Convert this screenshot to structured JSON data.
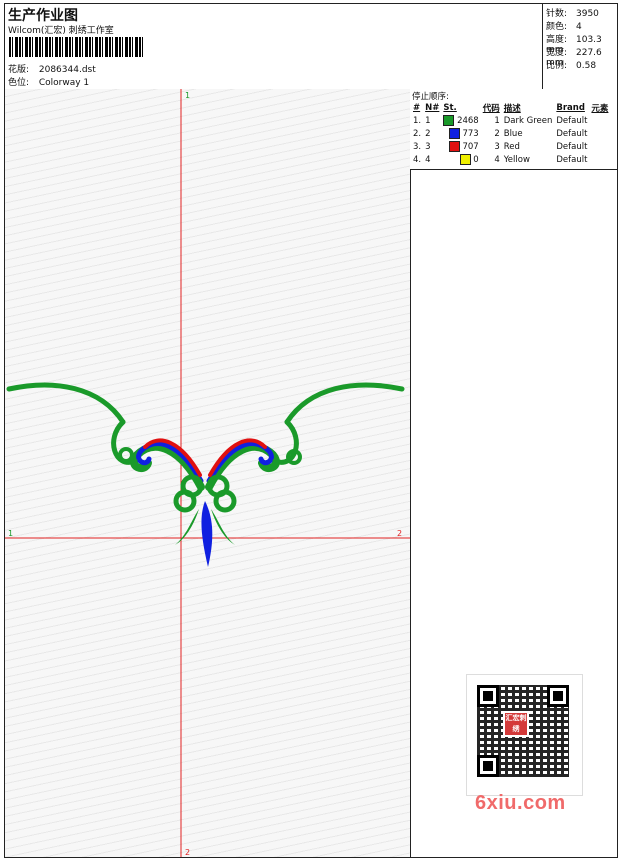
{
  "header": {
    "title": "生产作业图",
    "subtitle": "Wilcom(汇宏) 刺绣工作室",
    "pattern_label": "花版:",
    "pattern_value": "2086344.dst",
    "colorway_label": "色位:",
    "colorway_value": "Colorway 1"
  },
  "stats": [
    {
      "label": "针数:",
      "value": "3950"
    },
    {
      "label": "颜色:",
      "value": "4"
    },
    {
      "label": "高度:",
      "value": "103.3 mm"
    },
    {
      "label": "宽度:",
      "value": "227.6 mm"
    },
    {
      "label": "比例:",
      "value": "0.58"
    }
  ],
  "stop_sequence": {
    "caption": "停止顺序:",
    "columns": [
      "#",
      "N#",
      "St.",
      "代码",
      "描述",
      "Brand",
      "元素"
    ],
    "rows": [
      {
        "num": "1.",
        "n": "1",
        "color": "#1a9a2a",
        "stitches": "2468",
        "code": "1",
        "desc": "Dark Green",
        "brand": "Default"
      },
      {
        "num": "2.",
        "n": "2",
        "color": "#1020e0",
        "stitches": "773",
        "code": "2",
        "desc": "Blue",
        "brand": "Default"
      },
      {
        "num": "3.",
        "n": "3",
        "color": "#e01010",
        "stitches": "707",
        "code": "3",
        "desc": "Red",
        "brand": "Default"
      },
      {
        "num": "4.",
        "n": "4",
        "color": "#f0f000",
        "stitches": "0",
        "code": "4",
        "desc": "Yellow",
        "brand": "Default"
      }
    ]
  },
  "design": {
    "guide_color": "#e02020",
    "guide_labels": {
      "top": "1",
      "left": "1",
      "right": "2",
      "bottom": "2"
    }
  },
  "watermark": {
    "seal": "汇宏刺绣",
    "site": "6xiu.com"
  }
}
